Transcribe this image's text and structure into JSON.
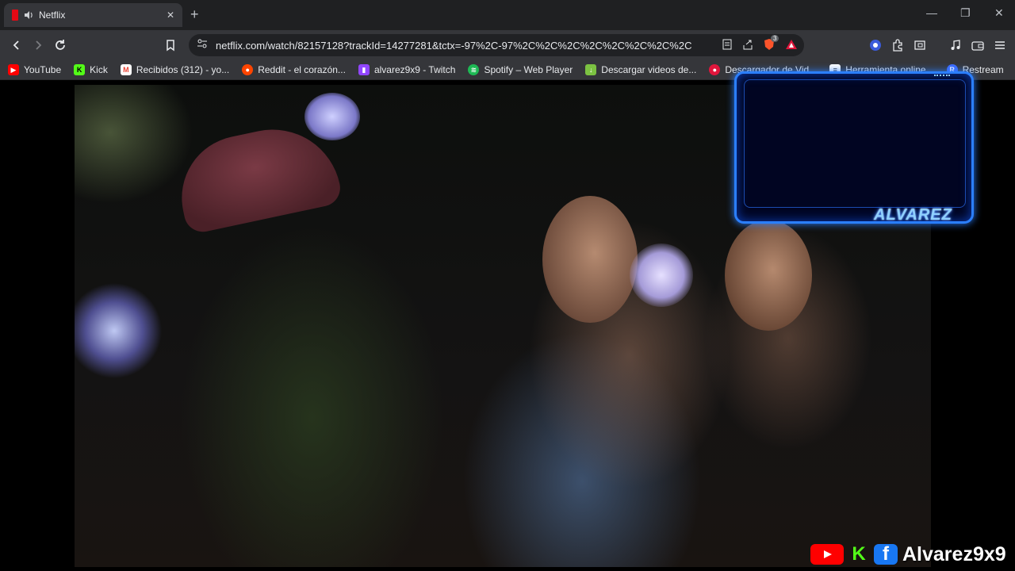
{
  "browser": {
    "tab": {
      "title": "Netflix"
    },
    "new_tab": "+",
    "window_controls": {
      "minimize": "—",
      "restore": "❐",
      "close": "✕"
    },
    "url": "netflix.com/watch/82157128?trackId=14277281&tctx=-97%2C-97%2C%2C%2C%2C%2C%2C%2C%2C%2C...",
    "brave_badge": "3"
  },
  "bookmarks": [
    {
      "label": "YouTube",
      "icon": "youtube-icon",
      "color": "#ff0000"
    },
    {
      "label": "Kick",
      "icon": "kick-icon",
      "color": "#53fc18"
    },
    {
      "label": "Recibidos (312) - yo...",
      "icon": "gmail-icon",
      "color": "#ea4335"
    },
    {
      "label": "Reddit - el corazón...",
      "icon": "reddit-icon",
      "color": "#ff4500"
    },
    {
      "label": "alvarez9x9 - Twitch",
      "icon": "twitch-icon",
      "color": "#9146ff"
    },
    {
      "label": "Spotify – Web Player",
      "icon": "spotify-icon",
      "color": "#1db954"
    },
    {
      "label": "Descargar videos de...",
      "icon": "download-icon",
      "color": "#7cc242"
    },
    {
      "label": "Descargador de Vid...",
      "icon": "downloader-icon",
      "color": "#e0163c"
    },
    {
      "label": "Herramienta online...",
      "icon": "tool-icon",
      "color": "#ffffff"
    },
    {
      "label": "Restream",
      "icon": "restream-icon",
      "color": "#3d6bff"
    }
  ],
  "overlay": {
    "name": "ALVAREZ"
  },
  "socials": {
    "handle": "Alvarez9x9",
    "kick_letter": "K",
    "fb_letter": "f"
  },
  "colors": {
    "accent_blue": "#2b7fff",
    "netflix_red": "#e50914"
  }
}
